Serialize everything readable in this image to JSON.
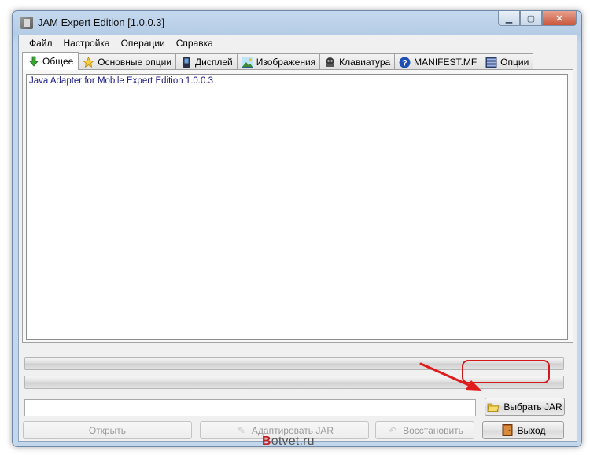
{
  "window": {
    "title": "JAM Expert Edition [1.0.0.3]"
  },
  "menu": [
    {
      "label": "Файл"
    },
    {
      "label": "Настройка"
    },
    {
      "label": "Операции"
    },
    {
      "label": "Справка"
    }
  ],
  "tabs": [
    {
      "label": "Общее",
      "icon": "green-down-arrow-icon",
      "active": true
    },
    {
      "label": "Основные опции",
      "icon": "star-icon"
    },
    {
      "label": "Дисплей",
      "icon": "phone-icon"
    },
    {
      "label": "Изображения",
      "icon": "image-icon"
    },
    {
      "label": "Клавиатура",
      "icon": "keyboard-icon"
    },
    {
      "label": "MANIFEST.MF",
      "icon": "help-icon"
    },
    {
      "label": "Опции",
      "icon": "list-icon"
    }
  ],
  "main": {
    "log_text": "Java Adapter for Mobile Expert Edition 1.0.0.3"
  },
  "path_field": {
    "value": ""
  },
  "buttons": {
    "select_jar": "Выбрать JAR",
    "open": "Открыть",
    "adapt": "Адаптировать JAR",
    "restore": "Восстановить",
    "exit": "Выход"
  },
  "watermark": {
    "first": "B",
    "rest": "otvet.ru"
  },
  "colors": {
    "highlight": "#d41a1a",
    "title_bar": "#b5cce6"
  }
}
